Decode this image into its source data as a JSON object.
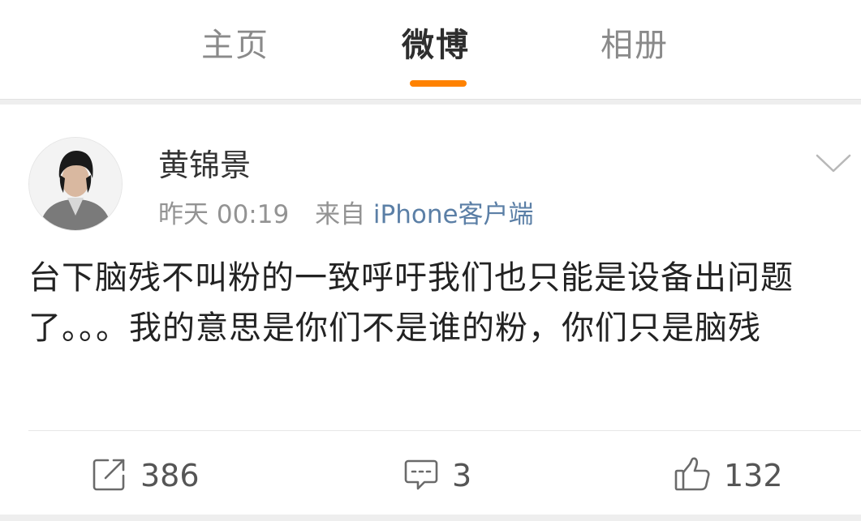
{
  "tabs": [
    {
      "label": "主页"
    },
    {
      "label": "微博"
    },
    {
      "label": "相册"
    }
  ],
  "accent_color": "#ff8200",
  "post": {
    "author": "黄锦景",
    "time": "昨天 00:19",
    "source_prefix": "来自",
    "source": "iPhone客户端",
    "text": "台下脑残不叫粉的一致呼吁我们也只能是设备出问题了。。。我的意思是你们不是谁的粉，你们只是脑残",
    "icons": {
      "more": "chevron-down-icon",
      "repost": "share-arrow-icon",
      "comment": "comment-bubble-icon",
      "like": "thumbs-up-icon"
    }
  },
  "actions": {
    "repost_count": "386",
    "comment_count": "3",
    "like_count": "132"
  }
}
